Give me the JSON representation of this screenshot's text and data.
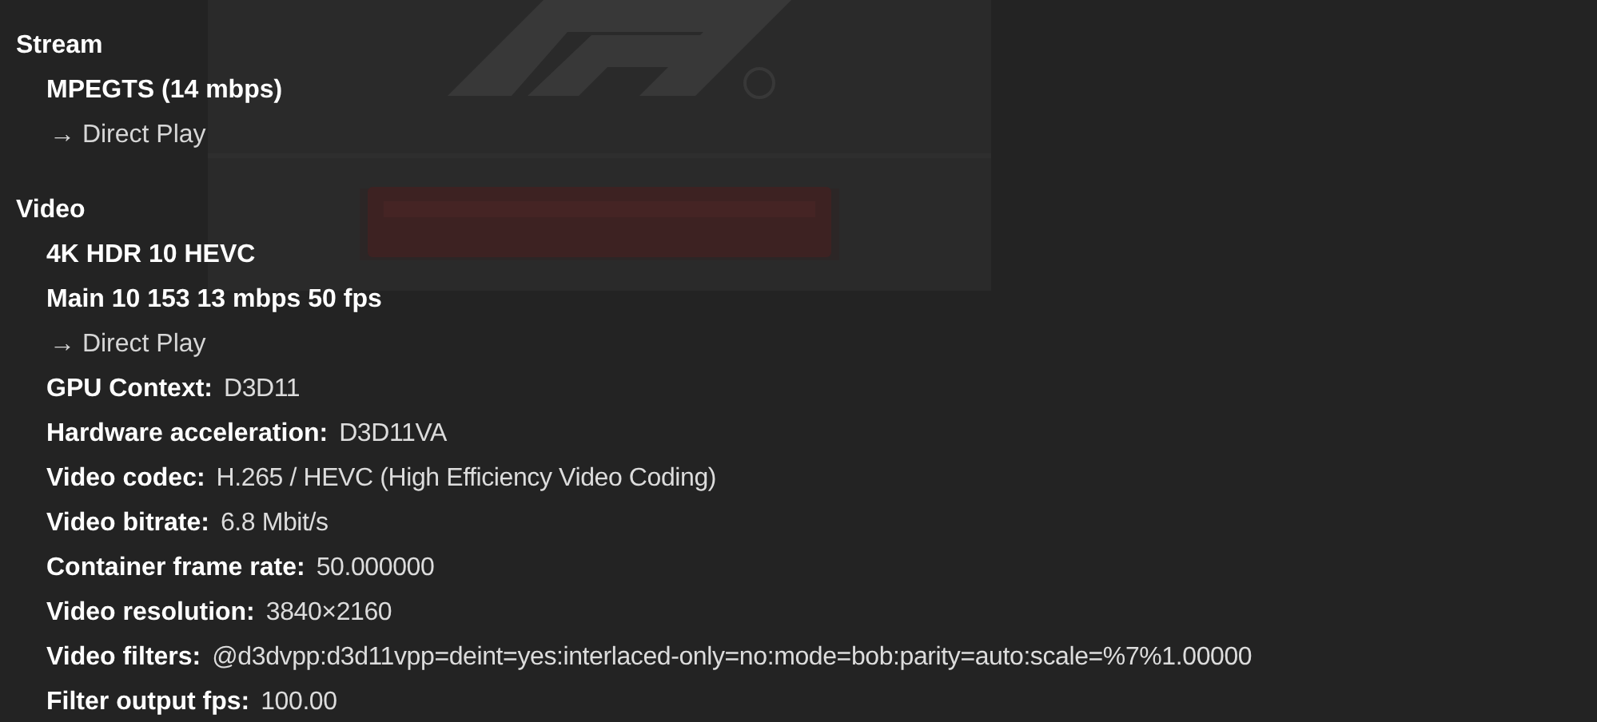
{
  "sections": [
    {
      "title": "Stream",
      "lines": [
        {
          "kind": "bold",
          "text": "MPEGTS (14 mbps)"
        },
        {
          "kind": "route",
          "text": "→ Direct Play"
        }
      ]
    },
    {
      "title": "Video",
      "lines": [
        {
          "kind": "bold",
          "text": "4K HDR 10 HEVC"
        },
        {
          "kind": "bold",
          "text": "Main 10 153 13 mbps 50 fps"
        },
        {
          "kind": "route",
          "text": "→ Direct Play"
        },
        {
          "kind": "field",
          "label": "GPU Context:",
          "value": "D3D11"
        },
        {
          "kind": "field",
          "label": "Hardware acceleration:",
          "value": "D3D11VA"
        },
        {
          "kind": "field",
          "label": "Video codec:",
          "value": "H.265 / HEVC (High Efficiency Video Coding)"
        },
        {
          "kind": "field",
          "label": "Video bitrate:",
          "value": "6.8 Mbit/s"
        },
        {
          "kind": "field",
          "label": "Container frame rate:",
          "value": "50.000000"
        },
        {
          "kind": "field",
          "label": "Video resolution:",
          "value": "3840×2160"
        },
        {
          "kind": "field",
          "label": "Video filters:",
          "value": "@d3dvpp:d3d11vpp=deint=yes:interlaced-only=no:mode=bob:parity=auto:scale=%7%1.00000"
        },
        {
          "kind": "field",
          "label": "Filter output fps:",
          "value": "100.00"
        }
      ]
    }
  ]
}
